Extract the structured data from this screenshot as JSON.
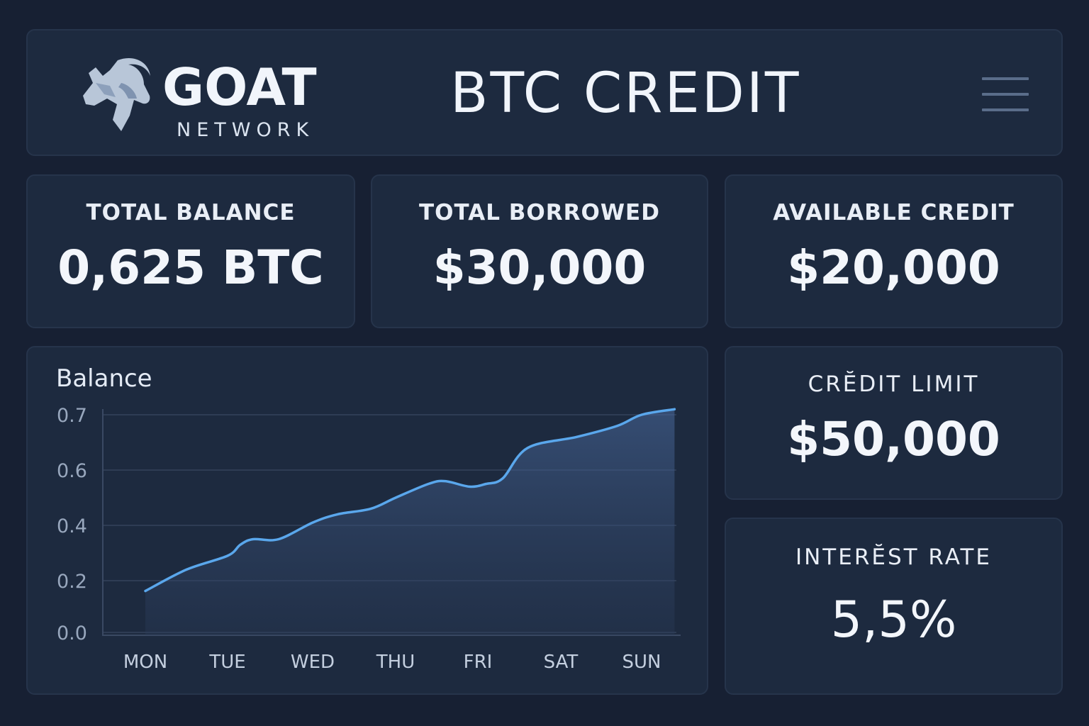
{
  "header": {
    "brand_name": "GOAT",
    "brand_sub": "NETWORK",
    "title": "BTC CREDIT",
    "logo_icon": "goat-head-icon",
    "menu_icon": "hamburger-menu-icon"
  },
  "stats": {
    "total_balance": {
      "label": "TOTAL BALANCE",
      "value": "0,625 BTC"
    },
    "total_borrowed": {
      "label": "TOTAL BORROWED",
      "value": "$30,000"
    },
    "available_credit": {
      "label": "AVAILABLE CREDIT",
      "value": "$20,000"
    },
    "credit_limit": {
      "label": "CRĔDIT LIMIT",
      "value": "$50,000"
    },
    "interest_rate": {
      "label": "INTERĔST RATE",
      "value": "5,5%"
    }
  },
  "colors": {
    "background": "#172033",
    "card": "#1d2a3f",
    "accent_line": "#5aa7ec",
    "text": "#f1f5fb"
  },
  "chart_data": {
    "type": "area",
    "title": "Balance",
    "categories": [
      "MON",
      "TUE",
      "WED",
      "THU",
      "FRI",
      "SAT",
      "SUN"
    ],
    "y_ticks": [
      "0.7",
      "0.6",
      "0.4",
      "0.2",
      "0.0"
    ],
    "series": [
      {
        "points": [
          [
            0.0,
            0.16
          ],
          [
            0.5,
            0.24
          ],
          [
            1.0,
            0.29
          ],
          [
            1.15,
            0.33
          ],
          [
            1.3,
            0.35
          ],
          [
            1.6,
            0.35
          ],
          [
            2.0,
            0.41
          ],
          [
            2.3,
            0.44
          ],
          [
            2.7,
            0.46
          ],
          [
            3.0,
            0.5
          ],
          [
            3.4,
            0.55
          ],
          [
            3.6,
            0.56
          ],
          [
            3.9,
            0.54
          ],
          [
            4.1,
            0.55
          ],
          [
            4.3,
            0.57
          ],
          [
            4.6,
            0.64
          ],
          [
            5.2,
            0.66
          ],
          [
            5.7,
            0.68
          ],
          [
            6.0,
            0.7
          ],
          [
            6.4,
            0.71
          ]
        ]
      }
    ],
    "grid": true
  }
}
